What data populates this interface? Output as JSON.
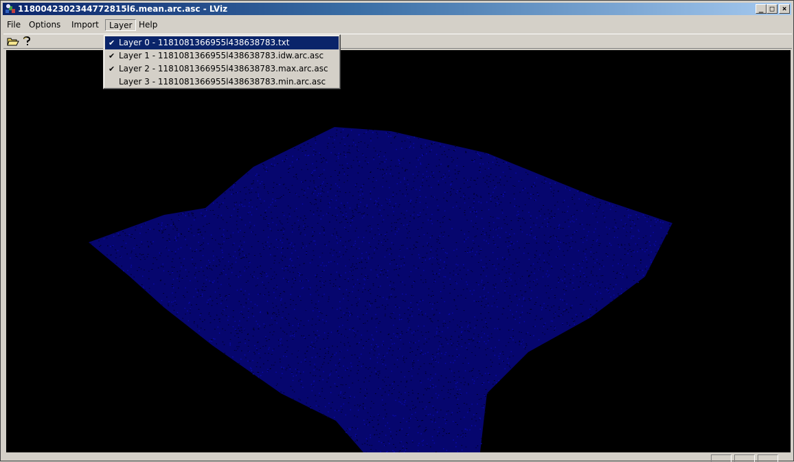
{
  "window": {
    "title": "1180042302344772815l6.mean.arc.asc - LViz",
    "controls": {
      "minimize": "_",
      "maximize": "□",
      "close": "×"
    }
  },
  "menu": [
    {
      "label": "File"
    },
    {
      "label": "Options"
    },
    {
      "label": "Import"
    },
    {
      "label": "Layer"
    },
    {
      "label": "Help"
    }
  ],
  "toolbar": {
    "buttons": [
      {
        "icon": "open-folder-icon"
      },
      {
        "icon": "help-icon"
      }
    ]
  },
  "layer_menu": {
    "items": [
      {
        "label": "Layer 0 - 1181081366955l438638783.txt",
        "checked": true,
        "selected": true
      },
      {
        "label": "Layer 1 - 1181081366955l438638783.idw.arc.asc",
        "checked": true,
        "selected": false
      },
      {
        "label": "Layer 2 - 1181081366955l438638783.max.arc.asc",
        "checked": true,
        "selected": false
      },
      {
        "label": "Layer 3 - 1181081366955l438638783.min.arc.asc",
        "checked": false,
        "selected": false
      }
    ],
    "check_glyph": "✔"
  },
  "viewport": {
    "background": "#000000",
    "point_color": "#0a0ab4"
  }
}
